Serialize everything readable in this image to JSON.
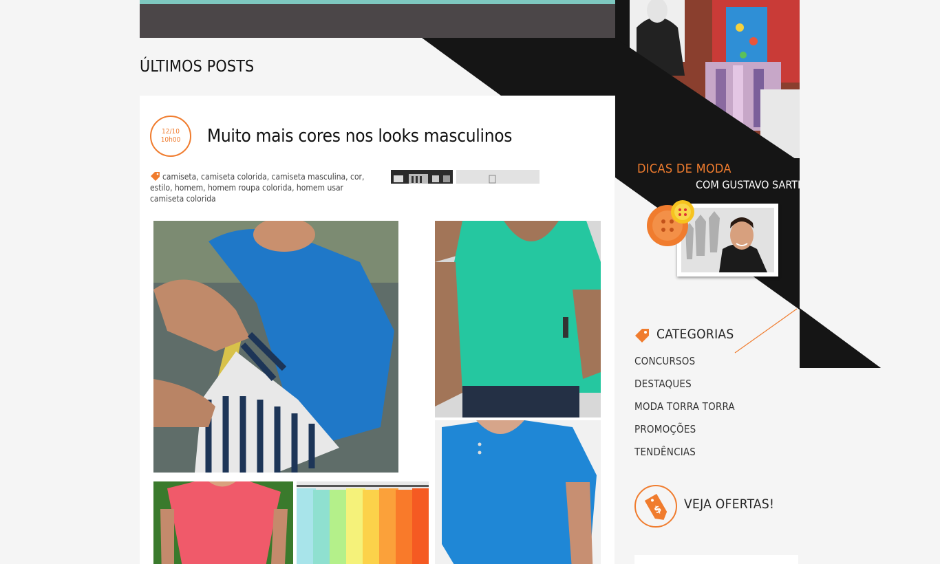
{
  "main": {
    "section_title": "ÚLTIMOS POSTS",
    "post": {
      "date": "12/10",
      "time": "10h00",
      "title": "Muito mais cores nos looks masculinos",
      "tags": "camiseta, camiseta colorida, camiseta masculina, cor, estilo, homem, homem roupa colorida, homem usar camiseta colorida"
    }
  },
  "sidebar": {
    "dicas_title": "DICAS DE MODA",
    "dicas_subtitle": "COM GUSTAVO SARTI",
    "categories_title": "CATEGORIAS",
    "categories": [
      "CONCURSOS",
      "DESTAQUES",
      "MODA TORRA TORRA",
      "PROMOÇÕES",
      "TENDÊNCIAS"
    ],
    "offers_title": "VEJA OFERTAS!"
  },
  "colors": {
    "accent": "#f07c2e",
    "dark": "#111111"
  }
}
